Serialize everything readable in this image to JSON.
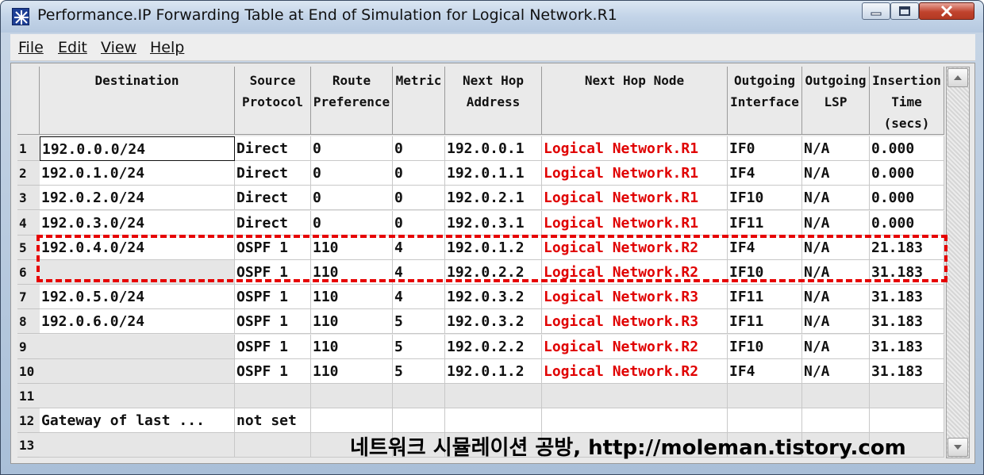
{
  "window": {
    "title": "Performance.IP Forwarding Table at End of Simulation for Logical Network.R1",
    "controls": [
      "minimize",
      "maximize",
      "close"
    ]
  },
  "menu": [
    {
      "label": "File"
    },
    {
      "label": "Edit"
    },
    {
      "label": "View"
    },
    {
      "label": "Help"
    }
  ],
  "table": {
    "columns": [
      [
        "Destination"
      ],
      [
        "Source",
        "Protocol"
      ],
      [
        "Route",
        "Preference"
      ],
      [
        "Metric"
      ],
      [
        "Next Hop",
        "Address"
      ],
      [
        "Next Hop Node"
      ],
      [
        "Outgoing",
        "Interface"
      ],
      [
        "Outgoing",
        "LSP"
      ],
      [
        "Insertion",
        "Time",
        "(secs)"
      ]
    ],
    "rows": [
      {
        "n": "1",
        "cells": [
          "192.0.0.0/24",
          "Direct",
          "0",
          "0",
          "192.0.0.1",
          "Logical Network.R1",
          "IF0",
          "N/A",
          "0.000"
        ]
      },
      {
        "n": "2",
        "cells": [
          "192.0.1.0/24",
          "Direct",
          "0",
          "0",
          "192.0.1.1",
          "Logical Network.R1",
          "IF4",
          "N/A",
          "0.000"
        ]
      },
      {
        "n": "3",
        "cells": [
          "192.0.2.0/24",
          "Direct",
          "0",
          "0",
          "192.0.2.1",
          "Logical Network.R1",
          "IF10",
          "N/A",
          "0.000"
        ]
      },
      {
        "n": "4",
        "cells": [
          "192.0.3.0/24",
          "Direct",
          "0",
          "0",
          "192.0.3.1",
          "Logical Network.R1",
          "IF11",
          "N/A",
          "0.000"
        ]
      },
      {
        "n": "5",
        "cells": [
          "192.0.4.0/24",
          "OSPF 1",
          "110",
          "4",
          "192.0.1.2",
          "Logical Network.R2",
          "IF4",
          "N/A",
          "21.183"
        ]
      },
      {
        "n": "6",
        "cells": [
          "",
          "OSPF 1",
          "110",
          "4",
          "192.0.2.2",
          "Logical Network.R2",
          "IF10",
          "N/A",
          "31.183"
        ]
      },
      {
        "n": "7",
        "cells": [
          "192.0.5.0/24",
          "OSPF 1",
          "110",
          "4",
          "192.0.3.2",
          "Logical Network.R3",
          "IF11",
          "N/A",
          "31.183"
        ]
      },
      {
        "n": "8",
        "cells": [
          "192.0.6.0/24",
          "OSPF 1",
          "110",
          "5",
          "192.0.3.2",
          "Logical Network.R3",
          "IF11",
          "N/A",
          "31.183"
        ]
      },
      {
        "n": "9",
        "cells": [
          "",
          "OSPF 1",
          "110",
          "5",
          "192.0.2.2",
          "Logical Network.R2",
          "IF10",
          "N/A",
          "31.183"
        ]
      },
      {
        "n": "10",
        "cells": [
          "",
          "OSPF 1",
          "110",
          "5",
          "192.0.1.2",
          "Logical Network.R2",
          "IF4",
          "N/A",
          "31.183"
        ]
      },
      {
        "n": "11",
        "cells": [
          "",
          "",
          "",
          "",
          "",
          "",
          "",
          "",
          ""
        ]
      },
      {
        "n": "12",
        "cells": [
          "Gateway of last ...",
          "not set",
          "",
          "",
          "",
          "",
          "",
          "",
          ""
        ]
      },
      {
        "n": "13",
        "cells": [
          "",
          "",
          "",
          "",
          "",
          "",
          "",
          "",
          ""
        ]
      }
    ]
  },
  "watermark": "네트워크 시뮬레이션 공방, http://moleman.tistory.com",
  "colors": {
    "next_hop_node": "#e00000",
    "highlight": "#e60000"
  }
}
